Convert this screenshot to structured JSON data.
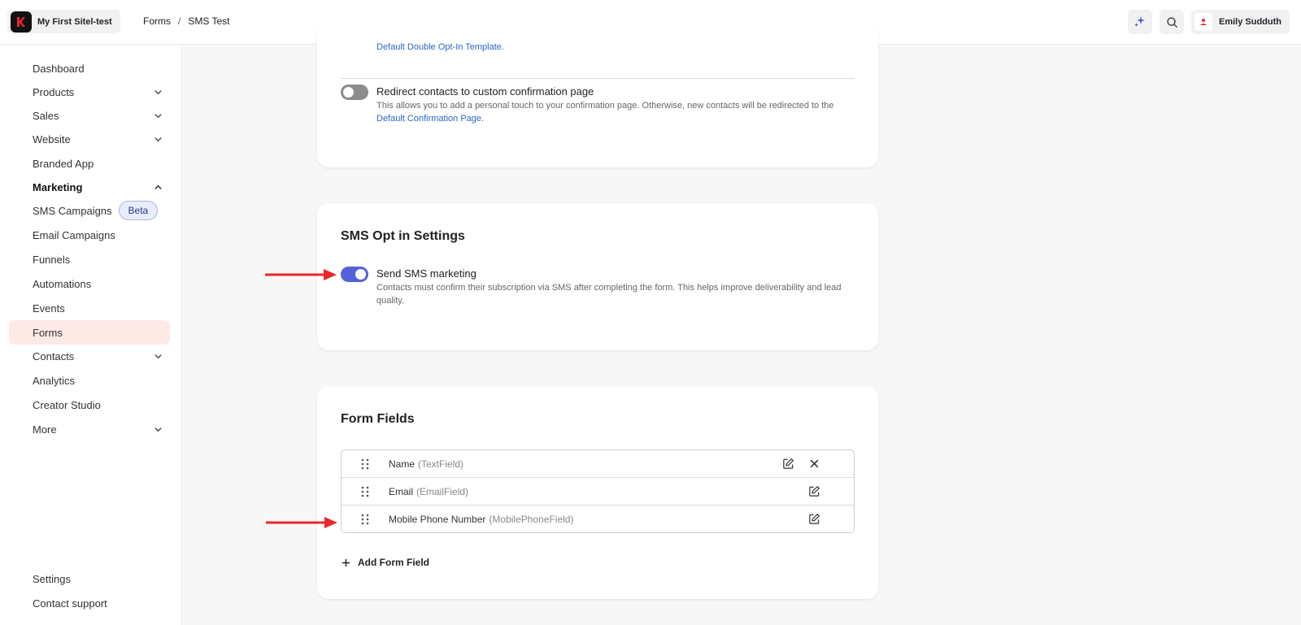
{
  "header": {
    "site_name": "My First Sitel-test",
    "breadcrumb": [
      "Forms",
      "SMS Test"
    ],
    "breadcrumb_sep": "/",
    "user_name": "Emily Sudduth"
  },
  "sidebar": {
    "items": [
      {
        "label": "Dashboard"
      },
      {
        "label": "Products",
        "chevron": "down"
      },
      {
        "label": "Sales",
        "chevron": "down"
      },
      {
        "label": "Website",
        "chevron": "down"
      },
      {
        "label": "Branded App"
      },
      {
        "label": "Marketing",
        "chevron": "up"
      },
      {
        "label": "SMS Campaigns",
        "badge": "Beta"
      },
      {
        "label": "Email Campaigns"
      },
      {
        "label": "Funnels"
      },
      {
        "label": "Automations"
      },
      {
        "label": "Events"
      },
      {
        "label": "Forms"
      },
      {
        "label": "Contacts",
        "chevron": "down"
      },
      {
        "label": "Analytics"
      },
      {
        "label": "Creator Studio"
      },
      {
        "label": "More",
        "chevron": "down"
      }
    ],
    "footer_items": [
      {
        "label": "Settings"
      },
      {
        "label": "Contact support"
      }
    ]
  },
  "confirmation_card": {
    "top_link": "Default Double Opt-In Template.",
    "redirect_title": "Redirect contacts to custom confirmation page",
    "redirect_desc": "This allows you to add a personal touch to your confirmation page. Otherwise, new contacts will be redirected to the",
    "redirect_link": "Default Confirmation Page",
    "redirect_enabled": false
  },
  "sms_card": {
    "title": "SMS Opt in Settings",
    "setting_title": "Send SMS marketing",
    "setting_desc": "Contacts must confirm their subscription via SMS after completing the form. This helps improve deliverability and lead quality.",
    "enabled": true
  },
  "fields_card": {
    "title": "Form Fields",
    "fields": [
      {
        "name": "Name",
        "type": "(TextField)",
        "removable": true
      },
      {
        "name": "Email",
        "type": "(EmailField)",
        "removable": false
      },
      {
        "name": "Mobile Phone Number",
        "type": "(MobilePhoneField)",
        "removable": false
      }
    ],
    "add_label": "Add Form Field"
  },
  "colors": {
    "accent": "#5461d8",
    "active_nav": "#fde9e6",
    "link": "#2b66c9",
    "annotation_arrow": "#e8262b"
  }
}
